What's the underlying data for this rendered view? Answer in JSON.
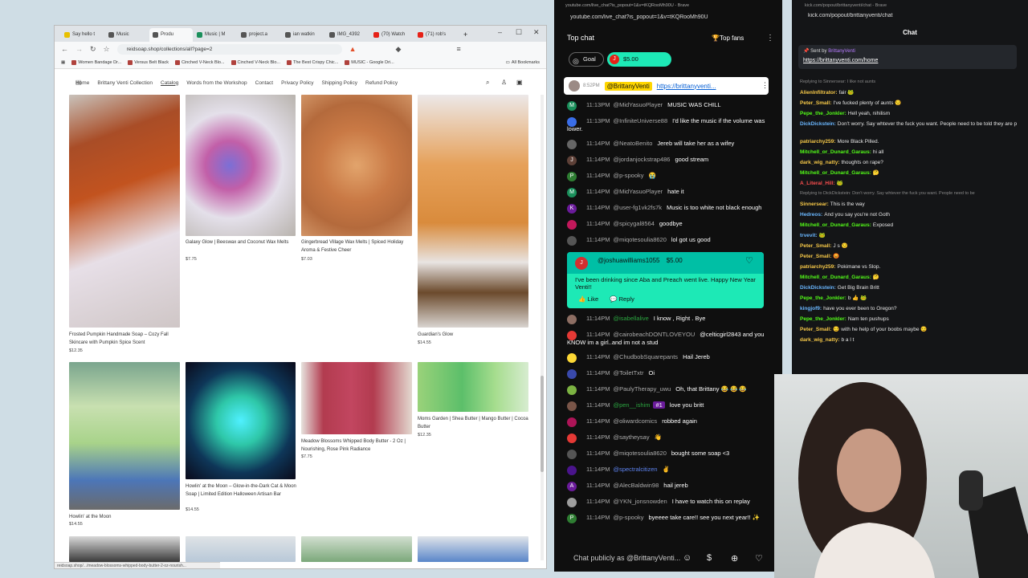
{
  "shop_browser": {
    "tabs": [
      {
        "label": "Say hello t",
        "color": "#e8c000"
      },
      {
        "label": "Music",
        "color": "#555555"
      },
      {
        "label": "Produ",
        "color": "#555555",
        "active": true
      },
      {
        "label": "Music | M",
        "color": "#1a8f5b"
      },
      {
        "label": "project.a",
        "color": "#555555"
      },
      {
        "label": "ian watkin",
        "color": "#555555"
      },
      {
        "label": "IMG_4392",
        "color": "#555555"
      },
      {
        "label": "(70) Watch",
        "color": "#e62117"
      },
      {
        "label": "(71) rob's",
        "color": "#e62117"
      }
    ],
    "new_tab": "+",
    "url": "reidsoap.shop/collections/all?page=2",
    "bookmarks": [
      "Women Bandage Dr...",
      "Versus Belt Black",
      "Cinched V-Neck Blo...",
      "Cinched V-Neck Blo...",
      "The Best Crispy Chic...",
      "MUSIC - Google Dri..."
    ],
    "all_bookmarks": "All Bookmarks",
    "status_url": "reidsoap.shop/.../meadow-blossoms-whipped-body-butter-2-oz-nourish..."
  },
  "shop": {
    "nav": [
      "Home",
      "Brittany Venti Collection",
      "Catalog",
      "Words from the Workshop",
      "Contact",
      "Privacy Policy",
      "Shipping Policy",
      "Refund Policy"
    ],
    "active_nav": "Catalog",
    "products": [
      {
        "title": "Frosted Pumpkin Handmade Soap – Cozy Fall Skincare with Pumpkin Spice Scent",
        "price": "$12.35"
      },
      {
        "title": "Galaxy Glow | Beeswax and Coconut Wax Melts",
        "price": "$7.75"
      },
      {
        "title": "Gingerbread Village Wax Melts | Spiced Holiday Aroma & Festive Cheer",
        "price": "$7.03"
      },
      {
        "title": "Guardian's Glow",
        "price": "$14.55"
      },
      {
        "title": "Howlin' at the Moon",
        "price": "$14.55"
      },
      {
        "title": "Howlin' at the Moon – Glow-in-the-Dark Cat & Moon Soap | Limited Edition Halloween Artisan Bar",
        "price": "$14.55"
      },
      {
        "title": "Meadow Blossoms Whipped Body Butter - 2 Oz | Nourishing, Rose Pink Radiance",
        "price": "$7.75"
      },
      {
        "title": "Moms Garden | Shea Butter | Mango Butter | Cocoa Butter",
        "price": "$12.35"
      }
    ]
  },
  "youtube_chat": {
    "window_title": "youtube.com/live_chat?is_popout=1&v=tKQRooMh90U - Brave",
    "url": "youtube.com/live_chat?is_popout=1&v=tKQRooMh90U",
    "top_chat": "Top chat",
    "top_fans": "Top fans",
    "goal": "Goal",
    "sc_amount": "$5.00",
    "pinned": {
      "time": "8:52PM",
      "user": "@BrittanyVenti",
      "link": "https://brittanyventi..."
    },
    "messages_before": [
      {
        "time": "11:13PM",
        "user": "@MidYasuoPlayer",
        "text": "MUSIC WAS CHILL",
        "color": "#1a8f5b",
        "initial": "M"
      },
      {
        "time": "11:13PM",
        "user": "@InfiniteUniverse88",
        "text": "I'd like the music if the volume was lower.",
        "color": "#3a6ee8",
        "initial": "",
        "member": true
      },
      {
        "time": "11:14PM",
        "user": "@NeatoBenito",
        "text": "Jereb will take her as a wifey",
        "color": "#666666",
        "initial": ""
      },
      {
        "time": "11:14PM",
        "user": "@jordanjockstrap486",
        "text": "good stream",
        "color": "#5d4037",
        "initial": "J"
      },
      {
        "time": "11:14PM",
        "user": "@p-spooky",
        "text": "😭",
        "color": "#2e7d32",
        "initial": "P"
      },
      {
        "time": "11:14PM",
        "user": "@MidYasuoPlayer",
        "text": "hate it",
        "color": "#1a8f5b",
        "initial": "M"
      },
      {
        "time": "11:14PM",
        "user": "@user-fg1vk2fs7k",
        "text": "Music is too white not black enough",
        "color": "#6a1b9a",
        "initial": "K"
      },
      {
        "time": "11:14PM",
        "user": "@spicygal8564",
        "text": "goodbye",
        "color": "#c2185b",
        "initial": ""
      },
      {
        "time": "11:14PM",
        "user": "@miqotesoulia8620",
        "text": "lol got us good",
        "color": "#555555",
        "initial": ""
      }
    ],
    "superchat": {
      "user": "@joshuawilliams1055",
      "amount": "$5.00",
      "text": "I've been drinking since Aba and Preach went live. Happy New Year Venti!!",
      "like": "Like",
      "reply": "Reply"
    },
    "messages_after": [
      {
        "time": "11:14PM",
        "user": "@isabellalive",
        "text": "I know , Right . Bye",
        "color": "#8d6e63",
        "initial": "",
        "mem": true
      },
      {
        "time": "11:14PM",
        "user": "@cairobeachDONTLOVEYOU",
        "text": "@celticgirl2843 and you KNOW im a girl..and im not a stud",
        "color": "#e53935",
        "initial": ""
      },
      {
        "time": "11:14PM",
        "user": "@ChudbobSquarepants",
        "text": "Hail Jereb",
        "color": "#fdd835",
        "initial": ""
      },
      {
        "time": "11:14PM",
        "user": "@ToiletTxtr",
        "text": "Oi",
        "color": "#3949ab",
        "initial": ""
      },
      {
        "time": "11:14PM",
        "user": "@PaulyTherapy_uwu",
        "text": "Oh, that Brittany 😂 😂 😂",
        "color": "#7cb342",
        "initial": ""
      },
      {
        "time": "11:14PM",
        "user": "@pen__ishim",
        "text": "love you britt",
        "color": "#795548",
        "initial": "",
        "mem": true,
        "badge": "#1"
      },
      {
        "time": "11:14PM",
        "user": "@oliwardcomics",
        "text": "robbed again",
        "color": "#ad1457",
        "initial": ""
      },
      {
        "time": "11:14PM",
        "user": "@saytheysay",
        "text": "👋",
        "color": "#e53935",
        "initial": ""
      },
      {
        "time": "11:14PM",
        "user": "@miqotesoulia8620",
        "text": "bought some soap <3",
        "color": "#555555",
        "initial": ""
      },
      {
        "time": "11:14PM",
        "user": "@spectralcitizen",
        "text": "✌",
        "color": "#4a148c",
        "initial": "",
        "mod": true
      },
      {
        "time": "11:14PM",
        "user": "@AlecBaldwin98",
        "text": "hail jereb",
        "color": "#6a1b9a",
        "initial": "A"
      },
      {
        "time": "11:14PM",
        "user": "@YKN_jonsnowden",
        "text": "I have to watch this on replay",
        "color": "#9e9e9e",
        "initial": ""
      },
      {
        "time": "11:14PM",
        "user": "@p-spooky",
        "text": "byeeee take care!! see you next year!! ✨",
        "color": "#2e7d32",
        "initial": "P"
      }
    ],
    "input_placeholder": "Chat publicly as @BrittanyVenti..."
  },
  "kick_chat": {
    "window_title": "kick.com/popout/brittanyventi/chat - Brave",
    "url": "kick.com/popout/brittanyventi/chat",
    "header": "Chat",
    "pinned_by": "Sent by",
    "pinned_user": "BrittanyVenti",
    "pinned_link": "https://brittanyventi.com/home",
    "messages": [
      {
        "user": "",
        "text": "Replying to Sinnersear: I like not aunts",
        "color": "#888888",
        "reply": true
      },
      {
        "user": "AlienInfiltrator:",
        "text": "fair 🐸",
        "color": "#f7c948"
      },
      {
        "user": "Peter_Small:",
        "text": "I've fucked plenty of aunts 😏",
        "color": "#f7c948"
      },
      {
        "user": "Pepe_the_Jonkler:",
        "text": "Hell yeah, nihilism",
        "color": "#53fc18"
      },
      {
        "user": "DickDickstein:",
        "text": "Don't worry. Say whtever the fuck you want. People need to be told they are pieces of shit.",
        "color": "#6ab7ff"
      },
      {
        "user": "",
        "text": "",
        "color": "#ffffff"
      },
      {
        "user": "patriarchy259:",
        "text": "More Black Pilled.",
        "color": "#f7c948"
      },
      {
        "user": "Mitchell_or_Dunard_Garaus:",
        "text": "hi all",
        "color": "#53fc18"
      },
      {
        "user": "dark_wig_natty:",
        "text": "thoughts on rape?",
        "color": "#f7c948"
      },
      {
        "user": "Mitchell_or_Dunard_Garaus:",
        "text": "🤔",
        "color": "#53fc18"
      },
      {
        "user": "A_Literal_Hill:",
        "text": "🐸",
        "color": "#ff4f4f"
      },
      {
        "user": "",
        "text": "Replying to DickDickstein: Don't worry. Say whtever the fuck you want. People need to be",
        "color": "#888888",
        "reply": true
      },
      {
        "user": "Sinnersear:",
        "text": "This is the way",
        "color": "#f7c948"
      },
      {
        "user": "Hedreos:",
        "text": "And you say you're not Goth",
        "color": "#6ab7ff"
      },
      {
        "user": "Mitchell_or_Dunard_Garaus:",
        "text": "Exposed",
        "color": "#53fc18"
      },
      {
        "user": "trvevit:",
        "text": "🐸",
        "color": "#6ab7ff"
      },
      {
        "user": "Peter_Small:",
        "text": "J s 😏",
        "color": "#f7c948"
      },
      {
        "user": "Peter_Small:",
        "text": "😡",
        "color": "#f7c948"
      },
      {
        "user": "patriarchy259:",
        "text": "Pokimane vs Slop.",
        "color": "#f7c948"
      },
      {
        "user": "Mitchell_or_Dunard_Garaus:",
        "text": "🤔",
        "color": "#53fc18"
      },
      {
        "user": "DickDickstein:",
        "text": "Get Big Brain Britt",
        "color": "#6ab7ff"
      },
      {
        "user": "Pepe_the_Jonkler:",
        "text": "b 👍 🐸",
        "color": "#53fc18"
      },
      {
        "user": "kingjof9:",
        "text": "have you ever been to Oregon?",
        "color": "#6ab7ff"
      },
      {
        "user": "Pepe_the_Jonkler:",
        "text": "Nam ten pushups",
        "color": "#53fc18"
      },
      {
        "user": "Peter_Small:",
        "text": "😏 with he help of your boobs maybe 😏",
        "color": "#f7c948"
      },
      {
        "user": "dark_wig_natty:",
        "text": "b a l t",
        "color": "#f7c948"
      }
    ]
  }
}
